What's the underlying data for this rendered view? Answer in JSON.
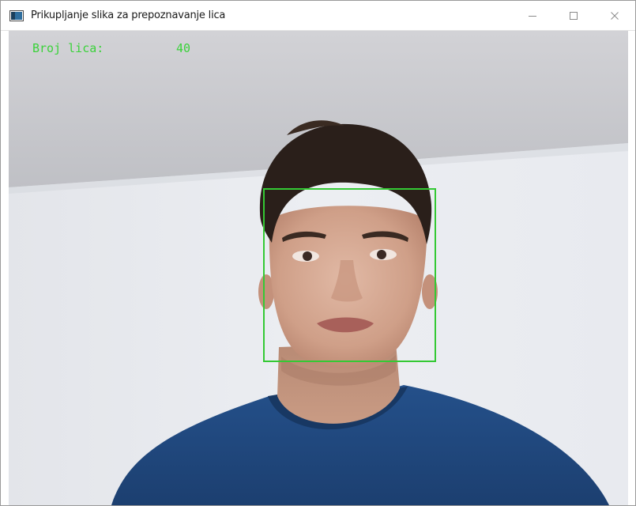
{
  "window": {
    "title": "Prikupljanje slika za prepoznavanje lica",
    "icon": "app-window-icon",
    "controls": [
      "minimize-icon",
      "maximize-icon",
      "close-icon"
    ]
  },
  "overlay": {
    "counter_label": "Broj lica:",
    "counter_value": "40",
    "text_color": "#3ad23a",
    "detection_box_color": "#34c934"
  },
  "camera_feed": {
    "description_icon": "webcam-frame"
  }
}
